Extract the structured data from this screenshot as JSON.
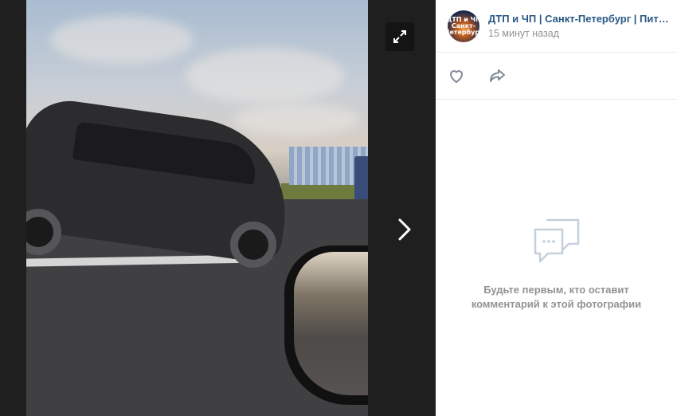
{
  "post": {
    "group_name": "ДТП и ЧП | Санкт-Петербург | Питер онлайн",
    "avatar_text": "ДТП и ЧП\nСанкт-Петербург",
    "time": "15 минут назад"
  },
  "icons": {
    "expand": "expand-icon",
    "next": "chevron-right-icon",
    "like": "heart-icon",
    "share": "share-arrow-icon",
    "comments": "comment-bubble-icon"
  },
  "comments": {
    "empty_line1": "Будьте первым, кто оставит",
    "empty_line2": "комментарий к этой фотографии"
  },
  "colors": {
    "link": "#2a5885",
    "muted": "#939393",
    "viewer_bg": "#1f1f1f",
    "icon_stroke": "#c5d0db"
  }
}
